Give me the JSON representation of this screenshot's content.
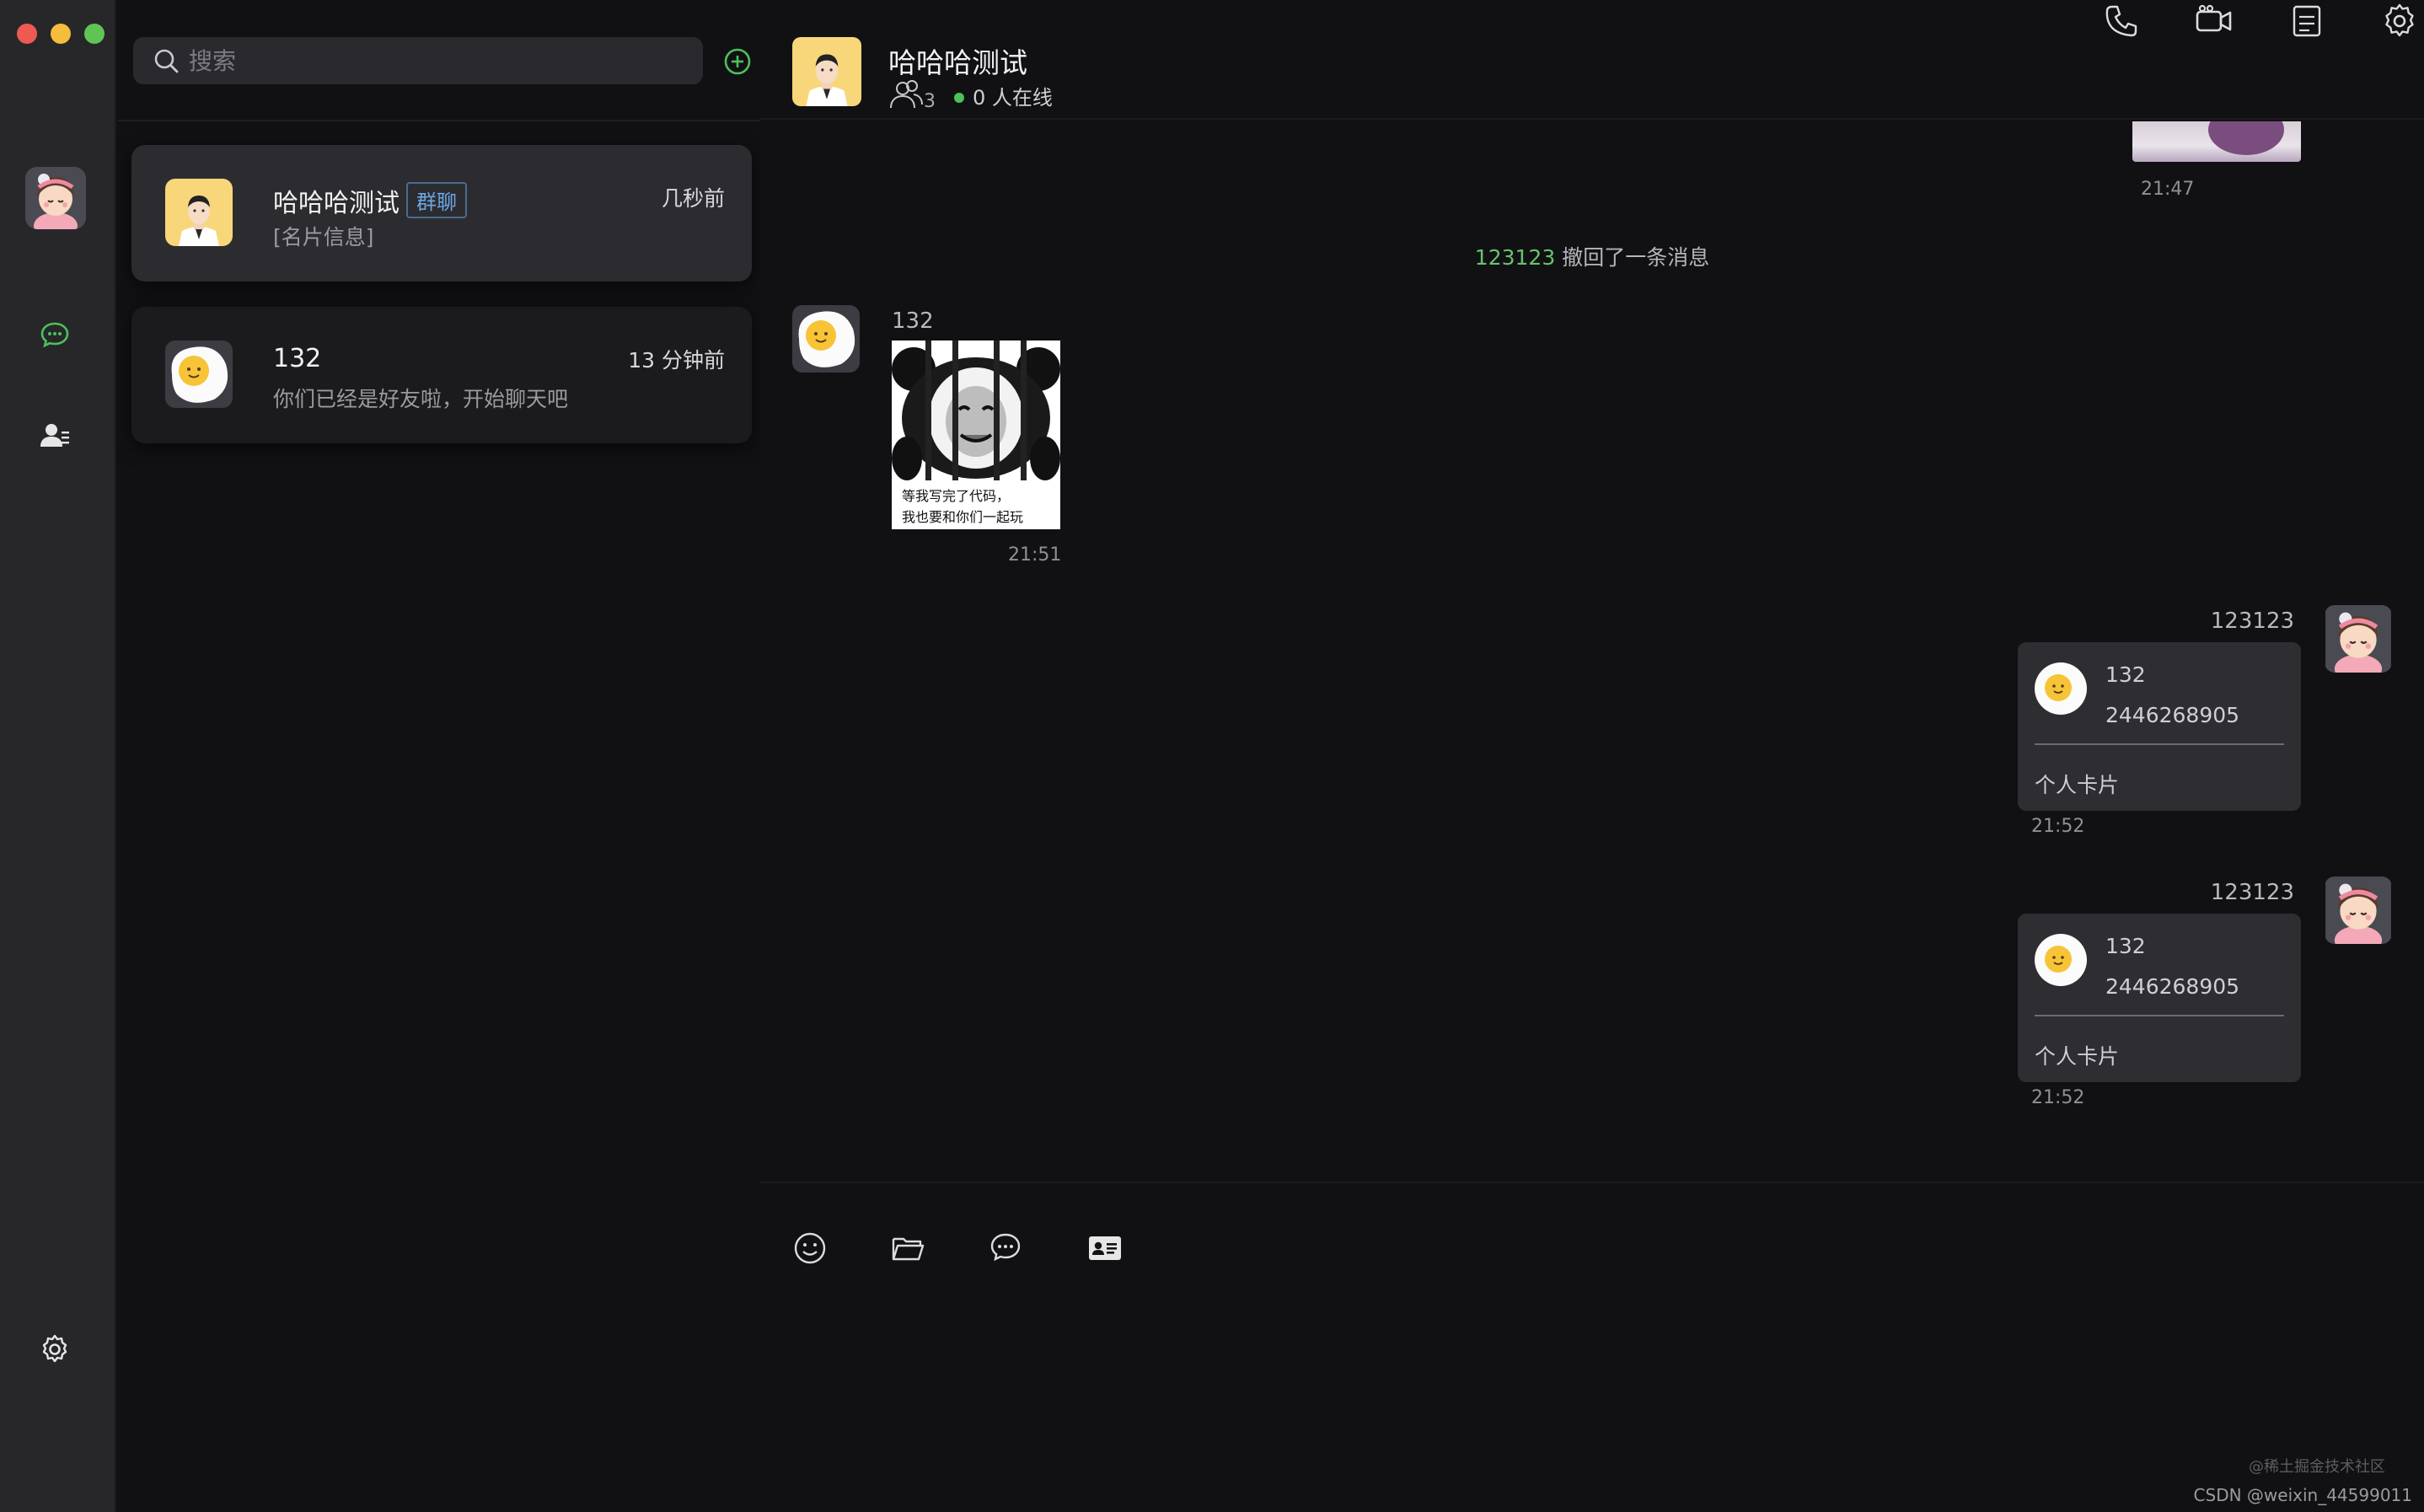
{
  "sidebar": {
    "traffic_lights": [
      "close",
      "minimize",
      "maximize"
    ],
    "nav": [
      {
        "icon": "avatar",
        "active": false
      },
      {
        "icon": "chat-bubble-icon",
        "active": true
      },
      {
        "icon": "contacts-icon",
        "active": false
      },
      {
        "icon": "gear-icon",
        "active": false
      }
    ],
    "accent_color": "#4cc25a"
  },
  "search": {
    "placeholder": "搜索"
  },
  "conversations": [
    {
      "name": "哈哈哈测试",
      "tag": "群聊",
      "preview": "[名片信息]",
      "time": "几秒前",
      "active": true
    },
    {
      "name": "132",
      "tag": "",
      "preview": "你们已经是好友啦，开始聊天吧",
      "time": "13 分钟前",
      "active": false
    }
  ],
  "chat": {
    "title": "哈哈哈测试",
    "member_count": "3",
    "online_text": "0 人在线",
    "header_icons": [
      "phone-icon",
      "video-call-icon",
      "notes-icon",
      "gear-icon"
    ],
    "messages": [
      {
        "type": "image-partial",
        "side": "right",
        "time": "21:47"
      },
      {
        "type": "recall",
        "who": "123123",
        "text": "撤回了一条消息"
      },
      {
        "type": "sticker",
        "side": "left",
        "sender": "132",
        "caption": [
          "等我写完了代码，",
          "我也要和你们一起玩"
        ],
        "time": "21:51"
      },
      {
        "type": "card",
        "side": "right",
        "sender": "123123",
        "card_name": "132",
        "card_id": "2446268905",
        "card_label": "个人卡片",
        "time": "21:52"
      },
      {
        "type": "card",
        "side": "right",
        "sender": "123123",
        "card_name": "132",
        "card_id": "2446268905",
        "card_label": "个人卡片",
        "time": "21:52"
      }
    ]
  },
  "composer": {
    "tools": [
      "emoji-icon",
      "folder-icon",
      "chat-history-icon",
      "contact-card-icon"
    ],
    "value": ""
  },
  "watermark": {
    "line1": "@稀土掘金技术社区",
    "line2": "CSDN @weixin_44599011"
  }
}
